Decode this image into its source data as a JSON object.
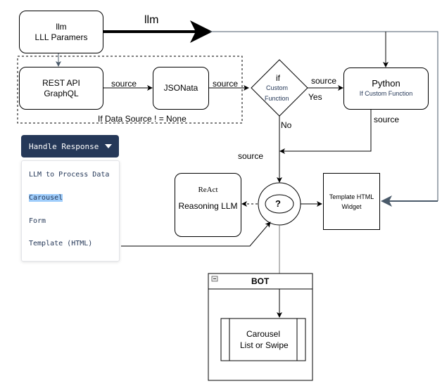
{
  "nodes": {
    "llm_params": {
      "line1": "llm",
      "line2": "LLL Paramers"
    },
    "rest_api": {
      "line1": "REST API",
      "line2": "GraphQL"
    },
    "jsonata": {
      "label": "JSONata"
    },
    "decision": {
      "line1": "if",
      "line2": "Custom",
      "line3": "Function"
    },
    "python": {
      "title": "Python",
      "subtitle": "If Custom Function"
    },
    "react": {
      "title": "ReAct",
      "subtitle": "Reasoning LLM"
    },
    "router": {
      "label": "?"
    },
    "template_widget": {
      "line1": "Template HTML",
      "line2": "Widget"
    },
    "bot": {
      "title": "BOT",
      "collapse_icon": "minus-square-icon"
    },
    "carousel": {
      "line1": "Carousel",
      "line2": "List or Swipe"
    }
  },
  "edges": {
    "llm_label": "llm",
    "rest_to_json": "source",
    "json_to_decision": "source",
    "decision_to_python": "source",
    "yes": "Yes",
    "no": "No",
    "python_out": "source",
    "to_router": "source"
  },
  "group": {
    "label": "If Data Source ! = None"
  },
  "dropdown": {
    "label": "Handle Response",
    "background": "#253858",
    "items": [
      "LLM to Process Data",
      "Carousel",
      "Form",
      "Template (HTML)"
    ],
    "selected": "Carousel"
  }
}
